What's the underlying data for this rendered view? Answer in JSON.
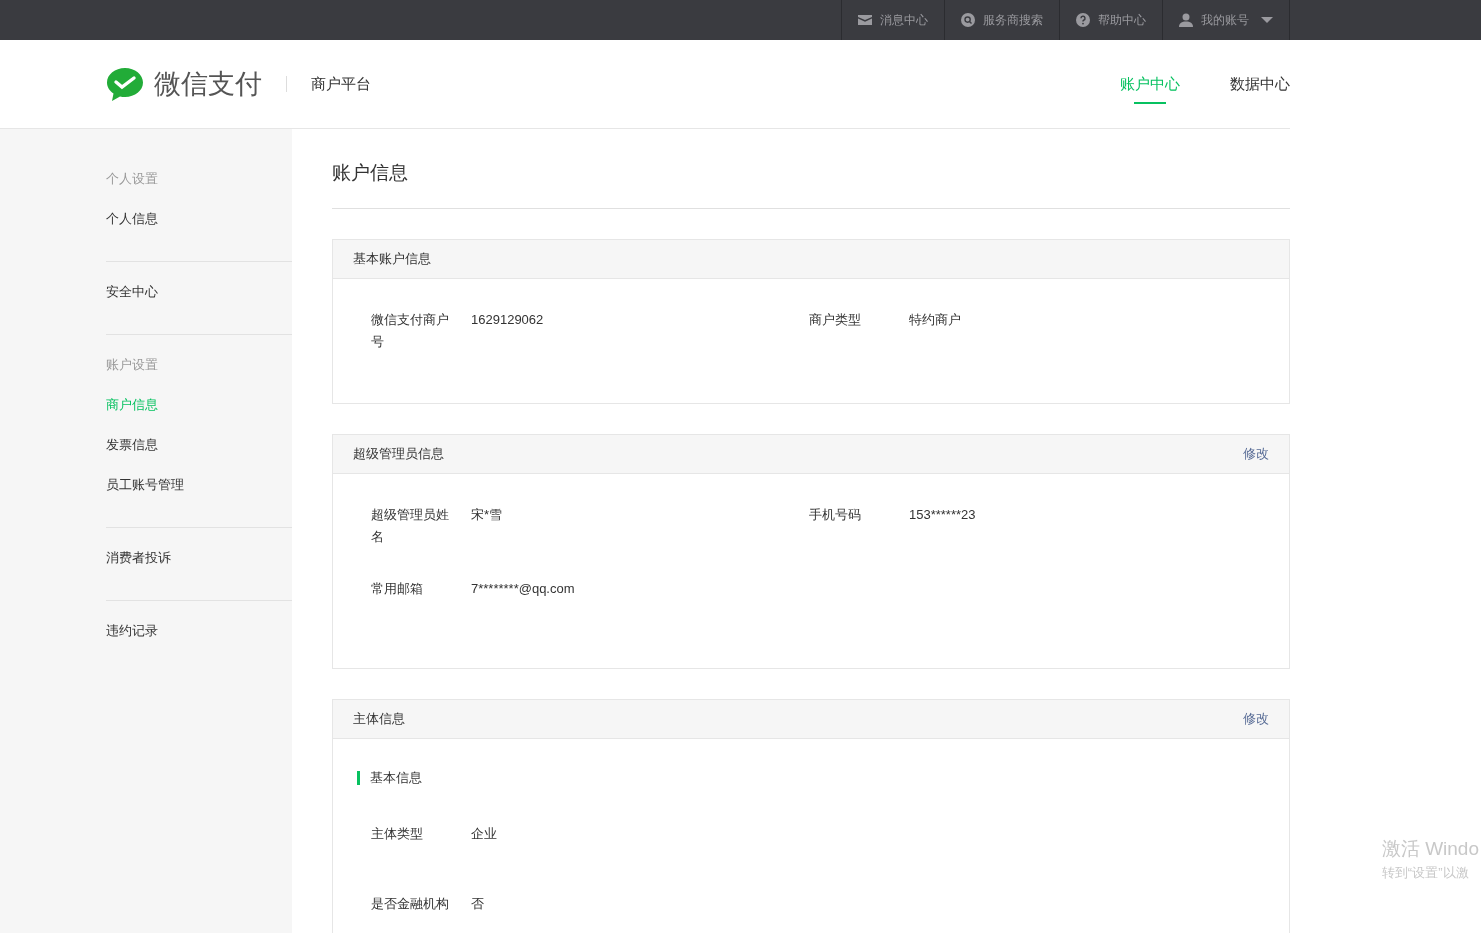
{
  "top_bar": {
    "items": [
      {
        "kind": "mail",
        "label": "消息中心"
      },
      {
        "kind": "search",
        "label": "服务商搜索"
      },
      {
        "kind": "help",
        "label": "帮助中心"
      },
      {
        "kind": "user",
        "label": "我的账号",
        "dropdown": true
      }
    ]
  },
  "header": {
    "brand": "微信支付",
    "platform": "商户平台",
    "tabs": [
      {
        "label": "账户中心",
        "selected": true
      },
      {
        "label": "数据中心",
        "selected": false
      }
    ]
  },
  "sidebar": {
    "groups": [
      {
        "title": "个人设置",
        "items": [
          {
            "label": "个人信息",
            "selected": false
          }
        ]
      },
      {
        "items": [
          {
            "label": "安全中心",
            "selected": false
          }
        ]
      },
      {
        "title": "账户设置",
        "items": [
          {
            "label": "商户信息",
            "selected": true
          },
          {
            "label": "发票信息",
            "selected": false
          },
          {
            "label": "员工账号管理",
            "selected": false
          }
        ]
      },
      {
        "items": [
          {
            "label": "消费者投诉",
            "selected": false
          }
        ]
      },
      {
        "items": [
          {
            "label": "违约记录",
            "selected": false
          }
        ]
      }
    ]
  },
  "main": {
    "title": "账户信息",
    "sections": [
      {
        "title": "基本账户信息",
        "rows": [
          [
            {
              "label": "微信支付商户号",
              "value": "1629129062"
            },
            {
              "label": "商户类型",
              "value": "特约商户"
            }
          ]
        ]
      },
      {
        "title": "超级管理员信息",
        "action": "修改",
        "rows": [
          [
            {
              "label": "超级管理员姓名",
              "value": "宋*雪"
            },
            {
              "label": "手机号码",
              "value": "153******23"
            }
          ],
          [
            {
              "label": "常用邮箱",
              "value": "7********@qq.com"
            }
          ]
        ]
      },
      {
        "title": "主体信息",
        "action": "修改",
        "subheading": "基本信息",
        "rows": [
          [
            {
              "label": "主体类型",
              "value": "企业"
            }
          ],
          [
            {
              "label": "是否金融机构",
              "value": "否"
            }
          ]
        ]
      }
    ]
  },
  "os_overlay": {
    "title": "激活 Windo",
    "hint": "转到“设置”以激"
  }
}
